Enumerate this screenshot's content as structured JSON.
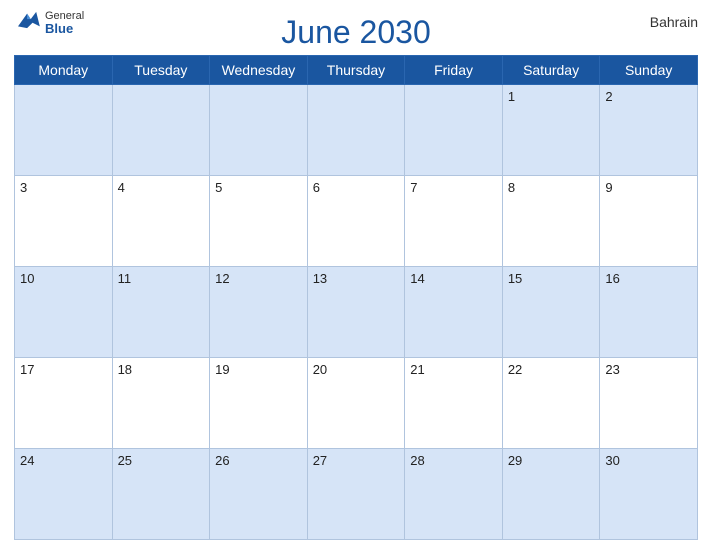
{
  "header": {
    "title": "June 2030",
    "country": "Bahrain",
    "logo_general": "General",
    "logo_blue": "Blue"
  },
  "calendar": {
    "days_of_week": [
      "Monday",
      "Tuesday",
      "Wednesday",
      "Thursday",
      "Friday",
      "Saturday",
      "Sunday"
    ],
    "weeks": [
      [
        "",
        "",
        "",
        "",
        "",
        "1",
        "2"
      ],
      [
        "3",
        "4",
        "5",
        "6",
        "7",
        "8",
        "9"
      ],
      [
        "10",
        "11",
        "12",
        "13",
        "14",
        "15",
        "16"
      ],
      [
        "17",
        "18",
        "19",
        "20",
        "21",
        "22",
        "23"
      ],
      [
        "24",
        "25",
        "26",
        "27",
        "28",
        "29",
        "30"
      ]
    ]
  }
}
